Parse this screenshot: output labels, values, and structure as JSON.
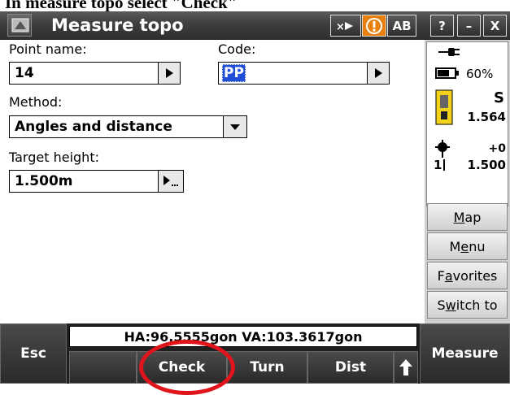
{
  "caption": "In measure topo select \"Check\"",
  "window": {
    "title": "Measure topo",
    "toolbar": {
      "keyboard_icon": "keyboard-arrow-icon",
      "alert_icon": "alert-icon",
      "input_mode_label": "AB",
      "help_label": "?",
      "minimize_label": "–",
      "close_label": "X"
    }
  },
  "form": {
    "point_name_label": "Point name:",
    "point_name_value": "14",
    "code_label": "Code:",
    "code_value": "PP",
    "method_label": "Method:",
    "method_value": "Angles and distance",
    "target_height_label": "Target height:",
    "target_height_value": "1.500m"
  },
  "status": {
    "battery_percent": "60%",
    "instrument_letter": "S",
    "instrument_value": "1.564",
    "target_offset": "+0",
    "target_number": "1",
    "target_value": "1.500"
  },
  "sidebar": {
    "items": [
      {
        "label_pre": "",
        "label_u": "M",
        "label_post": "ap"
      },
      {
        "label_pre": "M",
        "label_u": "e",
        "label_post": "nu"
      },
      {
        "label_pre": "F",
        "label_u": "a",
        "label_post": "vorites"
      },
      {
        "label_pre": "S",
        "label_u": "w",
        "label_post": "itch to"
      }
    ]
  },
  "bottom": {
    "esc_label": "Esc",
    "hava_text": "HA:96.5555gon  VA:103.3617gon",
    "check_label": "Check",
    "turn_label": "Turn",
    "dist_label": "Dist",
    "measure_label": "Measure"
  },
  "colors": {
    "selection": "#1f4fd8",
    "highlight_ring": "#e0141a"
  }
}
